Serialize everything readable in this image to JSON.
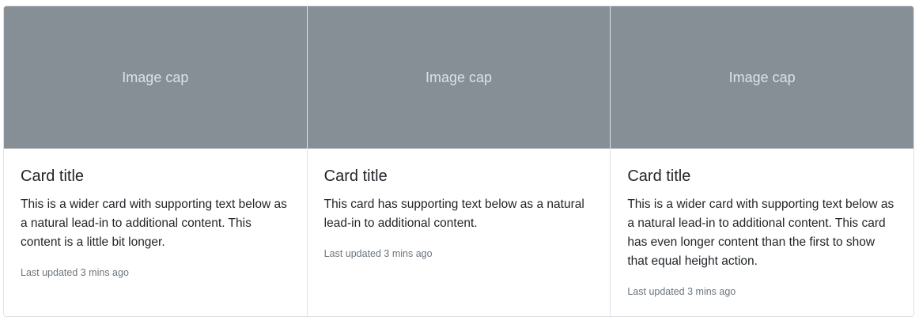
{
  "cards": [
    {
      "image_caption": "Image cap",
      "title": "Card title",
      "text": "This is a wider card with supporting text below as a natural lead-in to additional content. This content is a little bit longer.",
      "meta": "Last updated 3 mins ago"
    },
    {
      "image_caption": "Image cap",
      "title": "Card title",
      "text": "This card has supporting text below as a natural lead-in to additional content.",
      "meta": "Last updated 3 mins ago"
    },
    {
      "image_caption": "Image cap",
      "title": "Card title",
      "text": "This is a wider card with supporting text below as a natural lead-in to additional content. This card has even longer content than the first to show that equal height action.",
      "meta": "Last updated 3 mins ago"
    }
  ],
  "colors": {
    "image_placeholder_bg": "#868e96",
    "image_placeholder_text": "#dee2e6",
    "muted_text": "#6c757d",
    "border": "#dee2e6"
  }
}
